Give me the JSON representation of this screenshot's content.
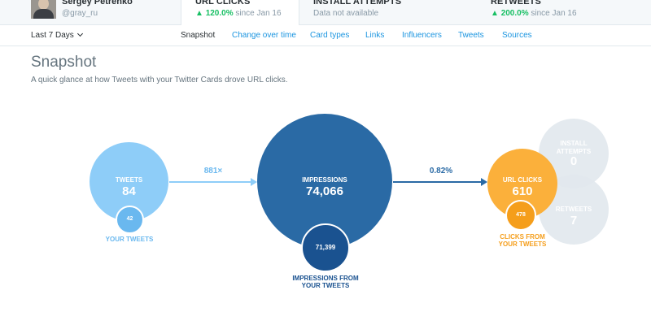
{
  "profile": {
    "name": "Sergey Petrenko",
    "handle": "@gray_ru"
  },
  "metrics": [
    {
      "title": "URL CLICKS",
      "arrow": "▲",
      "change": "120.0%",
      "since": "since Jan 16",
      "active": true
    },
    {
      "title": "INSTALL ATTEMPTS",
      "note": "Data not available",
      "active": false
    },
    {
      "title": "RETWEETS",
      "arrow": "▲",
      "change": "200.0%",
      "since": "since Jan 16",
      "active": false
    }
  ],
  "nav": {
    "range_label": "Last 7 Days",
    "tabs": [
      "Snapshot",
      "Change over time",
      "Card types",
      "Links",
      "Influencers",
      "Tweets",
      "Sources"
    ],
    "active_tab": "Snapshot"
  },
  "page": {
    "title": "Snapshot",
    "description": "A quick glance at how Tweets with your Twitter Cards drove URL clicks."
  },
  "diagram": {
    "tweets": {
      "label": "TWEETS",
      "value": "84",
      "sub_value": "42",
      "caption": "YOUR TWEETS"
    },
    "arrow1_label": "881×",
    "impressions": {
      "label": "IMPRESSIONS",
      "value": "74,066",
      "sub_value": "71,399",
      "caption_line1": "IMPRESSIONS FROM",
      "caption_line2": "YOUR TWEETS"
    },
    "arrow2_label": "0.82%",
    "url_clicks": {
      "label": "URL CLICKS",
      "value": "610",
      "sub_value": "478",
      "caption_line1": "CLICKS FROM",
      "caption_line2": "YOUR TWEETS"
    },
    "install_attempts": {
      "label_line1": "INSTALL",
      "label_line2": "ATTEMPTS",
      "value": "0"
    },
    "retweets": {
      "label": "RETWEETS",
      "value": "7"
    }
  },
  "colors": {
    "tweets": "#8ecdf8",
    "impressions": "#2a6aa5",
    "url_clicks": "#fbb03b",
    "inactive": "#e1e8ed",
    "link": "#1b95e0",
    "positive": "#17bf63"
  },
  "icons": {
    "range_dropdown": "chevron-down-icon",
    "change_up": "triangle-up-icon"
  }
}
